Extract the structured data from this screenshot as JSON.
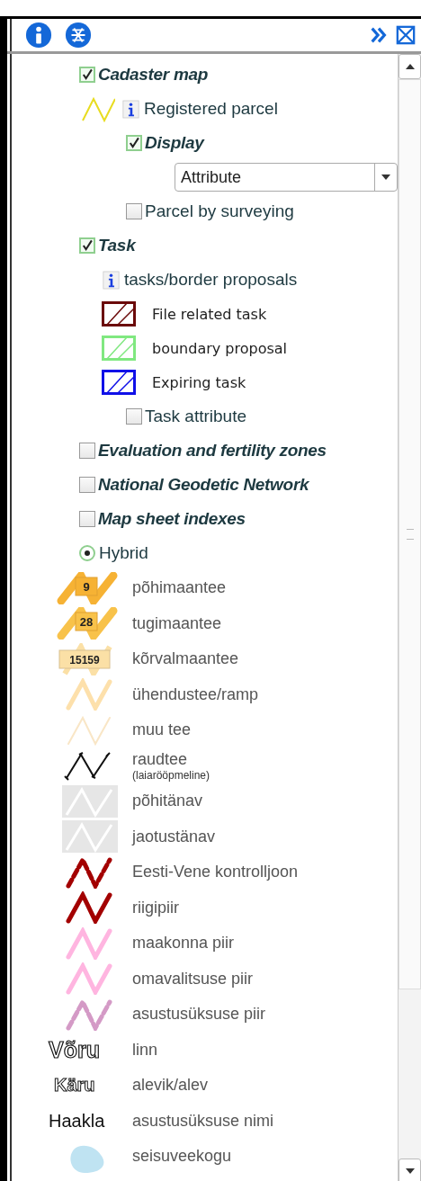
{
  "layers": [
    {
      "kind": "group",
      "label": "Cadaster map",
      "checked": true,
      "children": [
        {
          "kind": "line_info",
          "label": "Registered parcel",
          "children": [
            {
              "kind": "group",
              "label": "Display",
              "checked": true,
              "children": [
                {
                  "kind": "select",
                  "value": "Attribute"
                }
              ]
            },
            {
              "kind": "check",
              "label": "Parcel by surveying",
              "checked": false
            }
          ]
        }
      ]
    },
    {
      "kind": "group",
      "label": "Task",
      "checked": true,
      "children": [
        {
          "kind": "info",
          "label": "tasks/border proposals",
          "children": [
            {
              "kind": "swatch",
              "label": "File related task",
              "color": "#6b0a0a"
            },
            {
              "kind": "swatch",
              "label": "boundary proposal",
              "color": "#80e880"
            },
            {
              "kind": "swatch",
              "label": "Expiring task",
              "color": "#1010e8"
            },
            {
              "kind": "check",
              "label": "Task attribute",
              "checked": false
            }
          ]
        }
      ]
    },
    {
      "kind": "group",
      "label": "Evaluation and fertility zones",
      "checked": false
    },
    {
      "kind": "group",
      "label": "National Geodetic Network",
      "checked": false
    },
    {
      "kind": "group",
      "label": "Map sheet indexes",
      "checked": false
    },
    {
      "kind": "radio",
      "label": "Hybrid",
      "selected": true
    }
  ],
  "legend": [
    {
      "kind": "shield",
      "badge": "9",
      "label": "põhimaantee",
      "color": "#f6b234"
    },
    {
      "kind": "shield",
      "badge": "28",
      "label": "tugimaantee",
      "color": "#f8c24a"
    },
    {
      "kind": "plate",
      "badge": "15159",
      "label": "kõrvalmaantee",
      "color": "#fbe0a6"
    },
    {
      "kind": "line",
      "label": "ühendustee/ramp",
      "color": "#fde0ab"
    },
    {
      "kind": "thin",
      "label": "muu tee",
      "color": "#f9e6c6"
    },
    {
      "kind": "rail",
      "label": "raudtee",
      "note": "(laiarööpmeline)"
    },
    {
      "kind": "street",
      "label": "põhitänav"
    },
    {
      "kind": "street",
      "label": "jaotustänav"
    },
    {
      "kind": "dashed",
      "label": "Eesti-Vene kontrolljoon",
      "color": "#a30000"
    },
    {
      "kind": "line",
      "label": "riigipiir",
      "color": "#a30000"
    },
    {
      "kind": "line",
      "label": "maakonna piir",
      "color": "#ffb5e0"
    },
    {
      "kind": "line",
      "label": "omavalitsuse piir",
      "color": "#ffb5e0"
    },
    {
      "kind": "dashed",
      "label": "asustusüksuse piir",
      "color": "#d49ac6"
    },
    {
      "kind": "outline",
      "sample": "Võru",
      "label": "linn"
    },
    {
      "kind": "outline_small",
      "sample": "Käru",
      "label": "alevik/alev"
    },
    {
      "kind": "plain",
      "sample": "Haakla",
      "label": "asustusüksuse nimi"
    },
    {
      "kind": "water",
      "label": "seisuveekogu"
    }
  ]
}
